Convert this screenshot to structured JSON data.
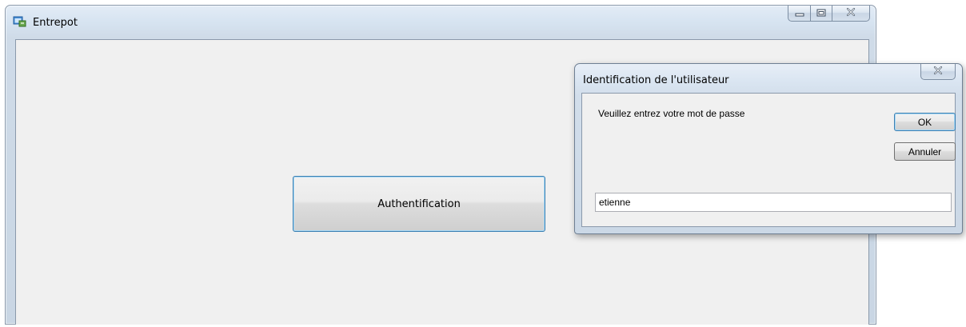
{
  "main_window": {
    "title": "Entrepot",
    "icon": "app-window-icon",
    "controls": [
      "minimize-icon",
      "maximize-icon",
      "close-icon"
    ],
    "auth_button_label": "Authentification"
  },
  "dialog": {
    "title": "Identification de l'utilisateur",
    "prompt": "Veuillez entrez votre mot de passe",
    "ok_label": "OK",
    "cancel_label": "Annuler",
    "input_value": "etienne",
    "close_icon": "close-icon"
  },
  "colors": {
    "chrome": "#cfdbe8",
    "client": "#f0f0f0",
    "focus_border": "#3c7fb1"
  }
}
